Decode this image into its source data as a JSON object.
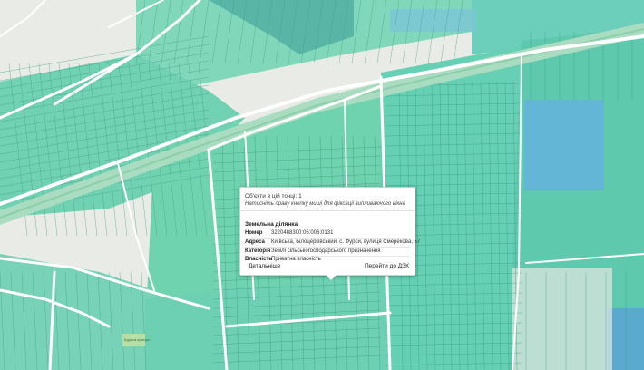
{
  "map": {
    "colors": {
      "land": "#e9ebe6",
      "parcel_green": "#6fd3b0",
      "parcel_teal": "#5ec6b0",
      "parcel_blue": "#64b6d6",
      "road": "#ffffff",
      "rail_band": "#a9dcc0"
    }
  },
  "popup": {
    "objects_count": "Об'єкти в цій точці: 1",
    "hint": "Натисніть праву кнопку миші для фіксації випливаючого вікна",
    "section_title": "Земельна ділянка",
    "rows": [
      {
        "key": "Номер",
        "value": "3220488300:05:006:0131"
      },
      {
        "key": "Адреса",
        "value": "Київська, Білоцерківський, с. Фурси, вулиця Смерекова, 57"
      },
      {
        "key": "Категорія",
        "value": "Землі сільськогосподарського призначення"
      },
      {
        "key": "Власність",
        "value": "Приватна власність"
      }
    ],
    "details_label": "Детальніше",
    "goto_label": "Перейти до ДЗК"
  },
  "labels": {
    "building_label": "Будинок культури"
  }
}
